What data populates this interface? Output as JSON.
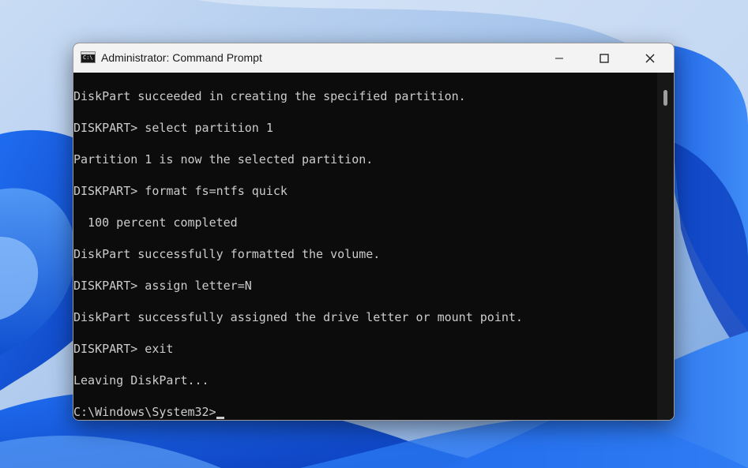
{
  "window": {
    "title": "Administrator: Command Prompt",
    "icon": "command-prompt-icon",
    "icon_glyph": "C:\\",
    "controls": [
      "minimize-icon",
      "maximize-icon",
      "close-icon"
    ]
  },
  "console": {
    "lines": [
      "DiskPart succeeded in creating the specified partition.",
      "DISKPART> select partition 1",
      "Partition 1 is now the selected partition.",
      "DISKPART> format fs=ntfs quick",
      "  100 percent completed",
      "DiskPart successfully formatted the volume.",
      "DISKPART> assign letter=N",
      "DiskPart successfully assigned the drive letter or mount point.",
      "DISKPART> exit",
      "Leaving DiskPart...",
      "C:\\Windows\\System32>"
    ]
  },
  "colors": {
    "console_bg": "#0c0c0c",
    "console_text": "#cccccc",
    "titlebar_bg": "#f3f3f3",
    "wallpaper_accent": "#0a4fd8"
  }
}
